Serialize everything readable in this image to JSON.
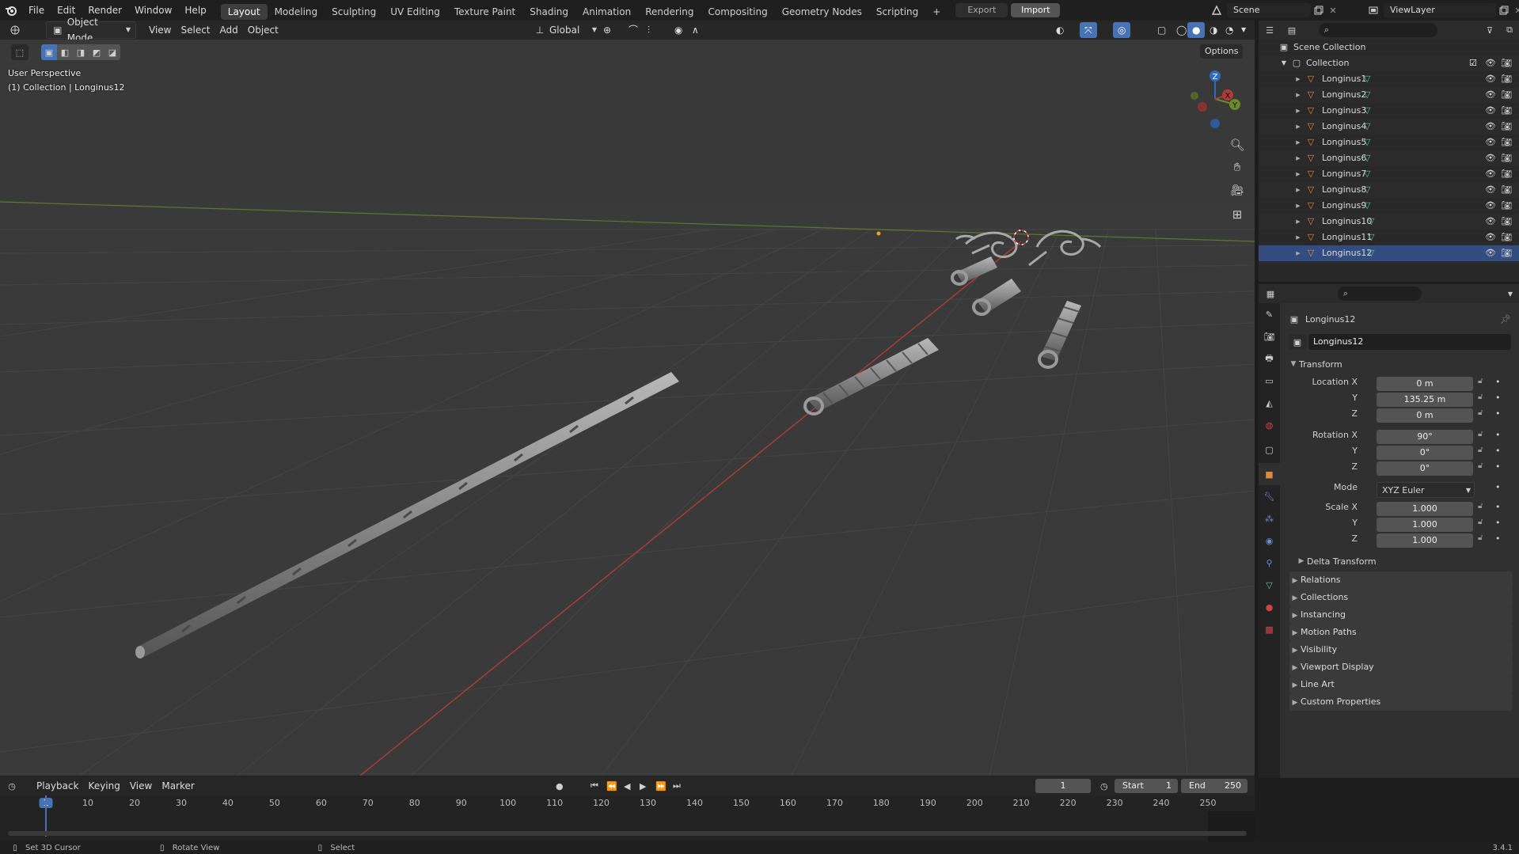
{
  "app": {
    "version": "3.4.1"
  },
  "topbar": {
    "menus": [
      "File",
      "Edit",
      "Render",
      "Window",
      "Help"
    ],
    "workspaces": [
      "Layout",
      "Modeling",
      "Sculpting",
      "UV Editing",
      "Texture Paint",
      "Shading",
      "Animation",
      "Rendering",
      "Compositing",
      "Geometry Nodes",
      "Scripting"
    ],
    "active_workspace": "Layout",
    "add_tab": "+",
    "export_label": "Export",
    "import_label": "Import",
    "scene_name": "Scene",
    "view_layer": "ViewLayer"
  },
  "viewport_header": {
    "mode": "Object Mode",
    "menus": [
      "View",
      "Select",
      "Add",
      "Object"
    ],
    "orientation": "Global",
    "options_label": "Options"
  },
  "viewport": {
    "perspective_label": "User Perspective",
    "collection_label": "(1) Collection | Longinus12",
    "gizmo_labels": {
      "z": "Z",
      "y": "Y",
      "x": "X"
    }
  },
  "outliner": {
    "root": "Scene Collection",
    "collection": "Collection",
    "objects": [
      "Longinus1",
      "Longinus2",
      "Longinus3",
      "Longinus4",
      "Longinus5",
      "Longinus6",
      "Longinus7",
      "Longinus8",
      "Longinus9",
      "Longinus10",
      "Longinus11",
      "Longinus12"
    ],
    "selected": "Longinus12"
  },
  "properties": {
    "object_name": "Longinus12",
    "datablock_name": "Longinus12",
    "transform_label": "Transform",
    "location_label": "Location X",
    "rotation_label": "Rotation X",
    "scale_label": "Scale X",
    "axis_y": "Y",
    "axis_z": "Z",
    "location": [
      "0 m",
      "135.25 m",
      "0 m"
    ],
    "rotation": [
      "90°",
      "0°",
      "0°"
    ],
    "mode_label": "Mode",
    "mode_value": "XYZ Euler",
    "scale": [
      "1.000",
      "1.000",
      "1.000"
    ],
    "delta_transform": "Delta Transform",
    "panels": [
      "Relations",
      "Collections",
      "Instancing",
      "Motion Paths",
      "Visibility",
      "Viewport Display",
      "Line Art",
      "Custom Properties"
    ]
  },
  "timeline": {
    "menus": [
      "Playback",
      "Keying",
      "View",
      "Marker"
    ],
    "current_frame": "1",
    "start_label": "Start",
    "start": "1",
    "end_label": "End",
    "end": "250",
    "ruler": [
      "1",
      "10",
      "20",
      "30",
      "40",
      "50",
      "60",
      "70",
      "80",
      "90",
      "100",
      "110",
      "120",
      "130",
      "140",
      "150",
      "160",
      "170",
      "180",
      "190",
      "200",
      "210",
      "220",
      "230",
      "240",
      "250"
    ]
  },
  "statusbar": {
    "hints": [
      "Set 3D Cursor",
      "Rotate View",
      "Select"
    ]
  },
  "colors": {
    "accent": "#4772b3",
    "selected_row": "#334d80",
    "x_axis": "#a33a3a",
    "y_axis": "#6b8a2a",
    "mesh_icon": "#e08b3c",
    "data_icon": "#63c39a"
  }
}
